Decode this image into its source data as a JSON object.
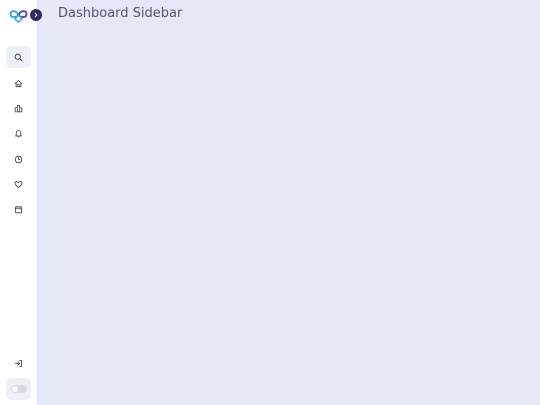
{
  "header": {
    "title": "Dashboard Sidebar"
  },
  "sidebar": {
    "logo_icon": "infinity-heart-logo",
    "collapse_icon": "chevron-right-icon",
    "items": [
      {
        "name": "search",
        "icon": "search-icon"
      },
      {
        "name": "home",
        "icon": "home-icon"
      },
      {
        "name": "buildings",
        "icon": "building-icon"
      },
      {
        "name": "notifications",
        "icon": "bell-icon"
      },
      {
        "name": "history",
        "icon": "clock-icon"
      },
      {
        "name": "favorites",
        "icon": "heart-icon"
      },
      {
        "name": "calendar",
        "icon": "calendar-icon"
      }
    ],
    "footer": {
      "logout_icon": "logout-icon",
      "theme_toggle": "off"
    }
  },
  "colors": {
    "main_background": "#e4e8f7",
    "sidebar_background": "#ffffff",
    "logo_blue": "#3fa9d6",
    "logo_purple": "#5b4aa8",
    "accent_dark": "#2c2c5e",
    "icon_color": "#3a3a4a"
  }
}
